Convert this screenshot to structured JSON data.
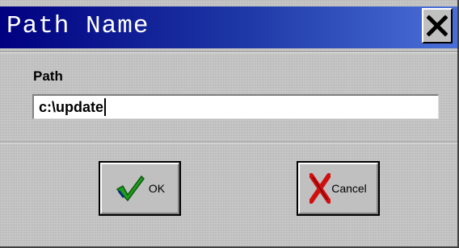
{
  "window": {
    "title": "Path Name",
    "close_icon": "close-x-icon"
  },
  "path": {
    "label": "Path",
    "value": "c:\\update"
  },
  "buttons": {
    "ok_label": "OK",
    "ok_icon": "checkmark-icon",
    "cancel_label": "Cancel",
    "cancel_icon": "red-x-icon"
  },
  "colors": {
    "titlebar_start": "#000080",
    "titlebar_end": "#4a6fd8",
    "face": "#c0c0c0",
    "check_green": "#1e9e1e",
    "cancel_red": "#d01010"
  }
}
